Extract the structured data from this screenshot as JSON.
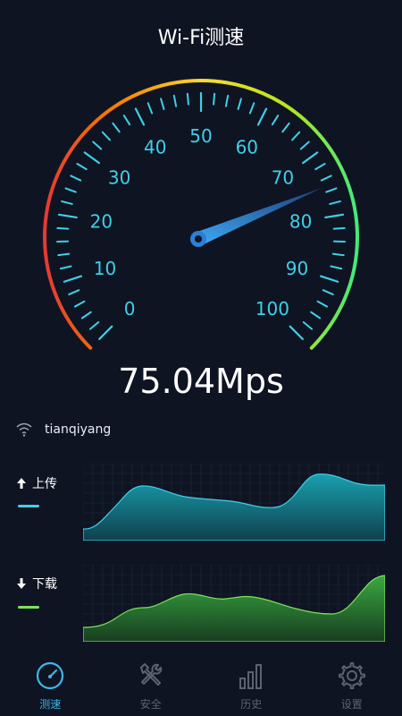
{
  "header": {
    "title": "Wi-Fi测速"
  },
  "gauge": {
    "tick_labels": [
      "0",
      "10",
      "20",
      "30",
      "40",
      "50",
      "60",
      "70",
      "80",
      "90",
      "100"
    ],
    "min": 0,
    "max": 100,
    "needle_value": 75.04,
    "colors": {
      "arc_start": "#e53935",
      "arc_mid": "#fdd835",
      "arc_end": "#43e97b",
      "tick": "#3fd0e8",
      "needle": "#2a7fd6"
    }
  },
  "speed": {
    "value_text": "75.04Mps"
  },
  "network": {
    "ssid": "tianqiyang",
    "icon": "wifi-icon"
  },
  "upload": {
    "label": "上传",
    "arrow_icon": "arrow-up-icon",
    "color": "#19b8c4",
    "line_color": "#3fd0e8"
  },
  "download": {
    "label": "下载",
    "arrow_icon": "arrow-down-icon",
    "color": "#3bb44a",
    "line_color": "#7ee25a"
  },
  "tabs": [
    {
      "label": "测速",
      "icon": "speedometer-icon",
      "active": true
    },
    {
      "label": "安全",
      "icon": "tools-icon",
      "active": false
    },
    {
      "label": "历史",
      "icon": "bar-chart-icon",
      "active": false
    },
    {
      "label": "设置",
      "icon": "gear-icon",
      "active": false
    }
  ]
}
